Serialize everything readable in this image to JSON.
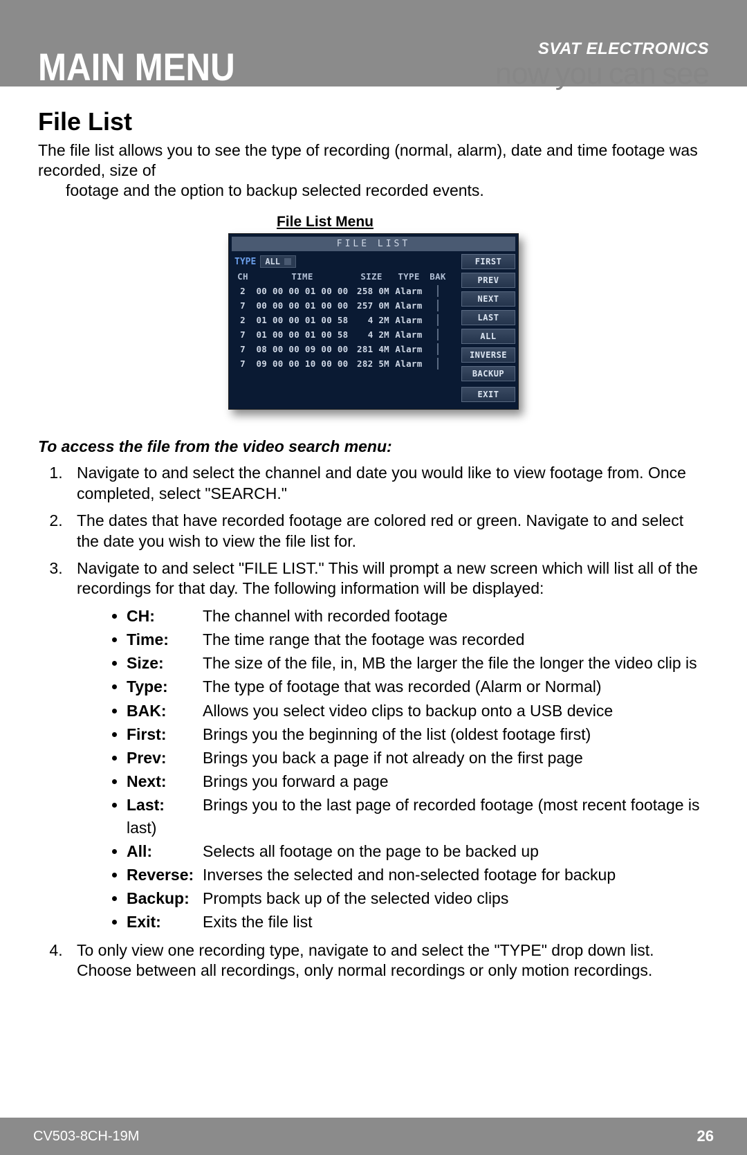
{
  "header": {
    "main_menu": "MAIN MENU",
    "brand_top": "SVAT ELECTRONICS",
    "brand_bottom": "now you can see"
  },
  "section": {
    "title": "File List",
    "intro_line1": "The file list allows you to see the type of recording (normal, alarm), date and time footage was recorded, size of",
    "intro_line2": "footage and the option to backup selected recorded events.",
    "screenshot_caption": "File List Menu"
  },
  "dvr": {
    "title": "FILE LIST",
    "type_label": "TYPE",
    "type_value": "ALL",
    "headers": {
      "ch": "CH",
      "time": "TIME",
      "size": "SIZE",
      "type": "TYPE",
      "bak": "BAK"
    },
    "rows": [
      {
        "ch": "2",
        "time": "00 00 00 01 00 00",
        "size": "258 0M",
        "type": "Alarm"
      },
      {
        "ch": "7",
        "time": "00 00 00 01 00 00",
        "size": "257 0M",
        "type": "Alarm"
      },
      {
        "ch": "2",
        "time": "01 00 00 01 00 58",
        "size": "4 2M",
        "type": "Alarm"
      },
      {
        "ch": "7",
        "time": "01 00 00 01 00 58",
        "size": "4 2M",
        "type": "Alarm"
      },
      {
        "ch": "7",
        "time": "08 00 00 09 00 00",
        "size": "281 4M",
        "type": "Alarm"
      },
      {
        "ch": "7",
        "time": "09 00 00 10 00 00",
        "size": "282 5M",
        "type": "Alarm"
      }
    ],
    "buttons": [
      "FIRST",
      "PREV",
      "NEXT",
      "LAST",
      "ALL",
      "INVERSE",
      "BACKUP"
    ],
    "exit": "EXIT"
  },
  "instructions": {
    "subhead": "To access the file from the video search menu:",
    "steps": [
      "Navigate to and select the channel and date you would like to view footage from.  Once completed, select \"SEARCH.\"",
      "The dates that have recorded footage are colored red or green.  Navigate to and select the date you wish to view the file list for.",
      "Navigate to and select \"FILE LIST.\"  This will prompt a new screen which will list all of the recordings for that day. The following information will be displayed:",
      "To only view one recording type, navigate to and select the \"TYPE\" drop down list. Choose between all recordings, only normal recordings or only motion recordings."
    ],
    "defs": [
      {
        "term": "CH:",
        "desc": "The channel with recorded footage"
      },
      {
        "term": "Time:",
        "desc": "The time range that the footage was recorded"
      },
      {
        "term": "Size:",
        "desc": "The size of the file, in, MB the larger the file the longer the video clip is"
      },
      {
        "term": "Type:",
        "desc": "The type of footage that was recorded (Alarm or Normal)"
      },
      {
        "term": "BAK:",
        "desc": "Allows you select video clips to backup onto a USB device"
      },
      {
        "term": "First:",
        "desc": "Brings you the beginning of the list (oldest footage first)"
      },
      {
        "term": "Prev:",
        "desc": "Brings you back a page if not already on the first page"
      },
      {
        "term": "Next:",
        "desc": "Brings you forward a page"
      },
      {
        "term": "Last:",
        "desc": "Brings you to the last page of recorded footage (most recent footage is last)"
      },
      {
        "term": "All:",
        "desc": "Selects all footage on the page to be backed up"
      },
      {
        "term": "Reverse:",
        "desc": "Inverses the selected and non-selected footage for backup"
      },
      {
        "term": "Backup:",
        "desc": "Prompts back up of the selected video clips"
      },
      {
        "term": "Exit:",
        "desc": "Exits the file list"
      }
    ]
  },
  "footer": {
    "model": "CV503-8CH-19M",
    "page": "26"
  }
}
